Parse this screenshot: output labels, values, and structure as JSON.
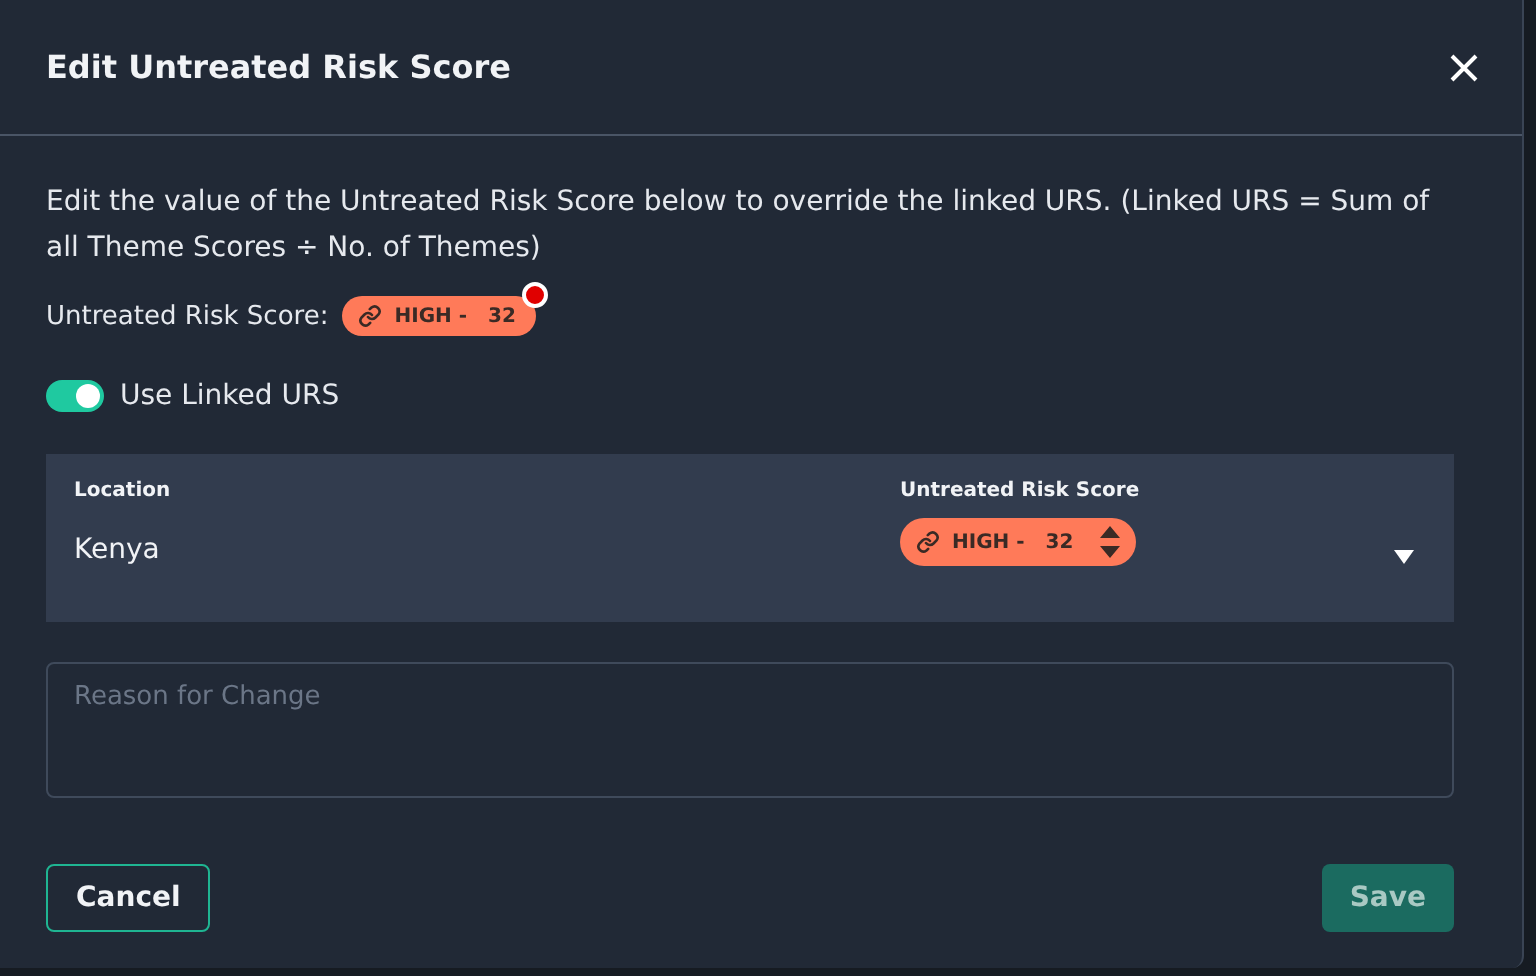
{
  "dialog": {
    "title": "Edit Untreated Risk Score"
  },
  "description": "Edit the value of the Untreated Risk Score below to override the linked URS. (Linked URS = Sum of all Theme Scores ÷ No. of Themes)",
  "score": {
    "label": "Untreated Risk Score:",
    "rating": "HIGH -",
    "value": "32",
    "changed": true
  },
  "use_linked": {
    "label": "Use Linked URS",
    "on": true
  },
  "table": {
    "columns": [
      "Location",
      "Untreated Risk Score"
    ],
    "rows": [
      {
        "location": "Kenya",
        "rating": "HIGH -",
        "value": "32"
      }
    ]
  },
  "reason": {
    "placeholder": "Reason for Change"
  },
  "buttons": [
    {
      "label": "Cancel",
      "kind": "secondary",
      "disabled": false
    },
    {
      "label": "Save",
      "kind": "primary",
      "disabled": true
    }
  ]
}
